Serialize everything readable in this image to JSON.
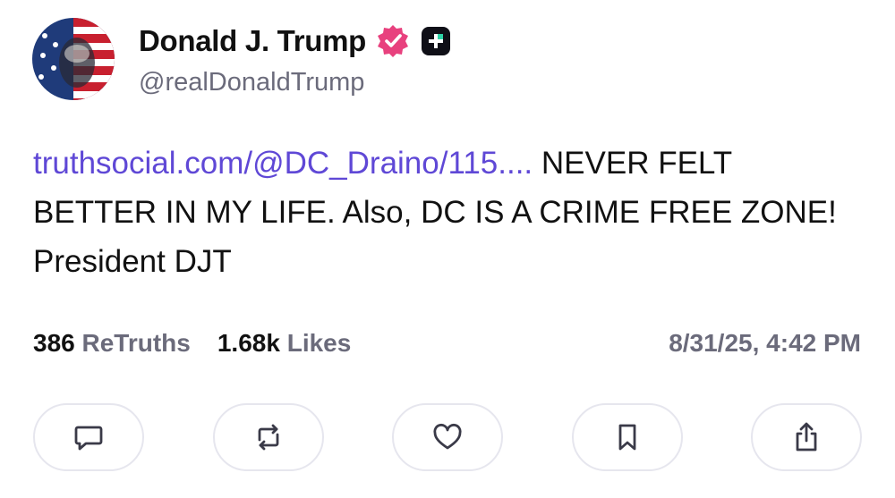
{
  "author": {
    "name": "Donald J. Trump",
    "handle": "@realDonaldTrump",
    "avatar_icon": "flag-portrait-avatar",
    "verified_icon": "verified-badge-icon",
    "verified_color": "#e8417e",
    "plus_icon": "plus-badge-icon"
  },
  "post": {
    "link_text": "truthsocial.com/@DC_Draino/115....",
    "body_text": " NEVER FELT BETTER IN MY LIFE. Also, DC IS A CRIME FREE ZONE! President DJT",
    "link_color": "#5f48d6"
  },
  "stats": {
    "retruths_count": "386",
    "retruths_label": "ReTruths",
    "likes_count": "1.68k",
    "likes_label": "Likes"
  },
  "timestamp": "8/31/25, 4:42 PM",
  "actions": [
    {
      "icon": "reply-icon"
    },
    {
      "icon": "retruth-icon"
    },
    {
      "icon": "like-heart-icon"
    },
    {
      "icon": "bookmark-icon"
    },
    {
      "icon": "share-icon"
    }
  ]
}
